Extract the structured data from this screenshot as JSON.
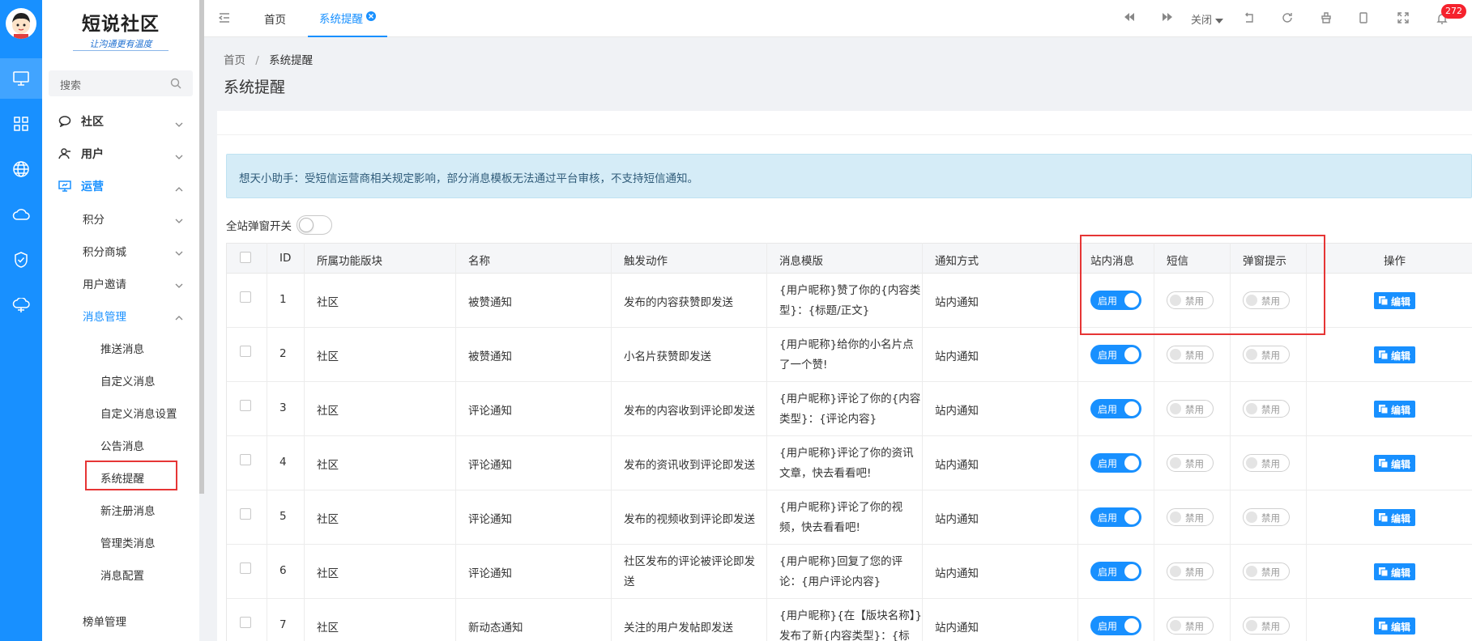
{
  "sidebar": {
    "logo_title": "短说社区",
    "logo_subtitle": "让沟通更有温度",
    "search_placeholder": "搜索",
    "menu": [
      {
        "label": "社区",
        "icon": "chat-icon"
      },
      {
        "label": "用户",
        "icon": "user-icon"
      },
      {
        "label": "运营",
        "icon": "presentation-icon"
      }
    ],
    "sub": [
      {
        "label": "积分"
      },
      {
        "label": "积分商城"
      },
      {
        "label": "用户邀请"
      },
      {
        "label": "消息管理"
      }
    ],
    "leaves": [
      "推送消息",
      "自定义消息",
      "自定义消息设置",
      "公告消息",
      "系统提醒",
      "新注册消息",
      "管理类消息",
      "消息配置"
    ],
    "bottom": "榜单管理"
  },
  "rail_icons": [
    "monitor-icon",
    "grid-icon",
    "globe-icon",
    "cloud-icon",
    "shield-icon",
    "cloud-network-icon"
  ],
  "tabs": {
    "home": "首页",
    "active": "系统提醒"
  },
  "toolbar": {
    "close_label": "关闭",
    "badge": "272"
  },
  "breadcrumb": {
    "home": "首页",
    "sep": "/",
    "current": "系统提醒"
  },
  "page_title": "系统提醒",
  "alert": "想天小助手：受短信运营商相关规定影响，部分消息模板无法通过平台审核，不支持短信通知。",
  "global_toggle_label": "全站弹窗开关",
  "table": {
    "headers": [
      "ID",
      "所属功能版块",
      "名称",
      "触发动作",
      "消息模版",
      "通知方式",
      "站内消息",
      "短信",
      "弹窗提示",
      "操作"
    ],
    "on_label": "启用",
    "off_label": "禁用",
    "edit_label": "编辑",
    "rows": [
      {
        "id": "1",
        "module": "社区",
        "name": "被赞通知",
        "action": "发布的内容获赞即发送",
        "tpl1": "{用户昵称}赞了你的{内容类",
        "tpl2": "型}：{标题/正文}",
        "method": "站内通知"
      },
      {
        "id": "2",
        "module": "社区",
        "name": "被赞通知",
        "action": "小名片获赞即发送",
        "tpl1": "{用户昵称}给你的小名片点",
        "tpl2": "了一个赞!",
        "method": "站内通知"
      },
      {
        "id": "3",
        "module": "社区",
        "name": "评论通知",
        "action": "发布的内容收到评论即发送",
        "tpl1": "{用户昵称}评论了你的{内容",
        "tpl2": "类型}：{评论内容}",
        "method": "站内通知"
      },
      {
        "id": "4",
        "module": "社区",
        "name": "评论通知",
        "action": "发布的资讯收到评论即发送",
        "tpl1": "{用户昵称}评论了你的资讯",
        "tpl2": "文章，快去看看吧!",
        "method": "站内通知"
      },
      {
        "id": "5",
        "module": "社区",
        "name": "评论通知",
        "action": "发布的视频收到评论即发送",
        "tpl1": "{用户昵称}评论了你的视",
        "tpl2": "频，快去看看吧!",
        "method": "站内通知"
      },
      {
        "id": "6",
        "module": "社区",
        "name": "评论通知",
        "action1": "社区发布的评论被评论即发",
        "action2": "送",
        "tpl1": "{用户昵称}回复了您的评",
        "tpl2": "论：{用户评论内容}",
        "method": "站内通知"
      },
      {
        "id": "7",
        "module": "社区",
        "name": "新动态通知",
        "action": "关注的用户发帖即发送",
        "tpl1": "{用户昵称}{在【版块名称】}",
        "tpl2": "发布了新{内容类型}：{标",
        "method": "站内通知"
      }
    ]
  }
}
